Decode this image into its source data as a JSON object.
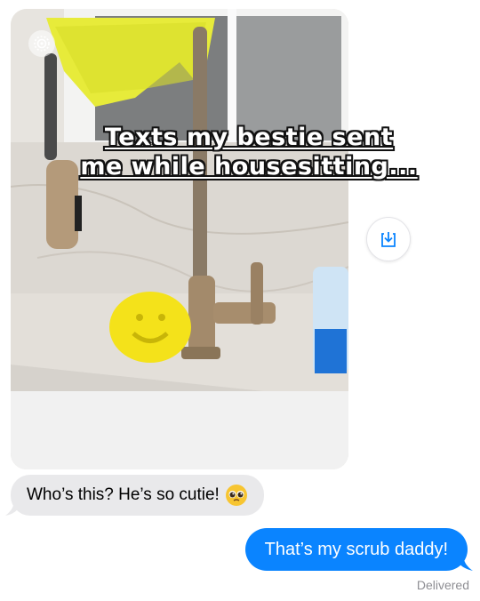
{
  "photo": {
    "caption_line1": "Texts my bestie sent",
    "caption_line2": "me while housesitting...",
    "live_icon": "live-photo-icon",
    "save_icon": "save-to-photos-icon"
  },
  "messages": [
    {
      "direction": "incoming",
      "text": "Who’s this? He’s so cutie!",
      "emoji": "pleading-face-emoji"
    },
    {
      "direction": "outgoing",
      "text": "That’s my scrub daddy!"
    }
  ],
  "status": {
    "delivered": "Delivered"
  },
  "colors": {
    "outgoing_bubble": "#0a84ff",
    "incoming_bubble": "#e9e9eb",
    "sponge": "#f4e21a"
  }
}
